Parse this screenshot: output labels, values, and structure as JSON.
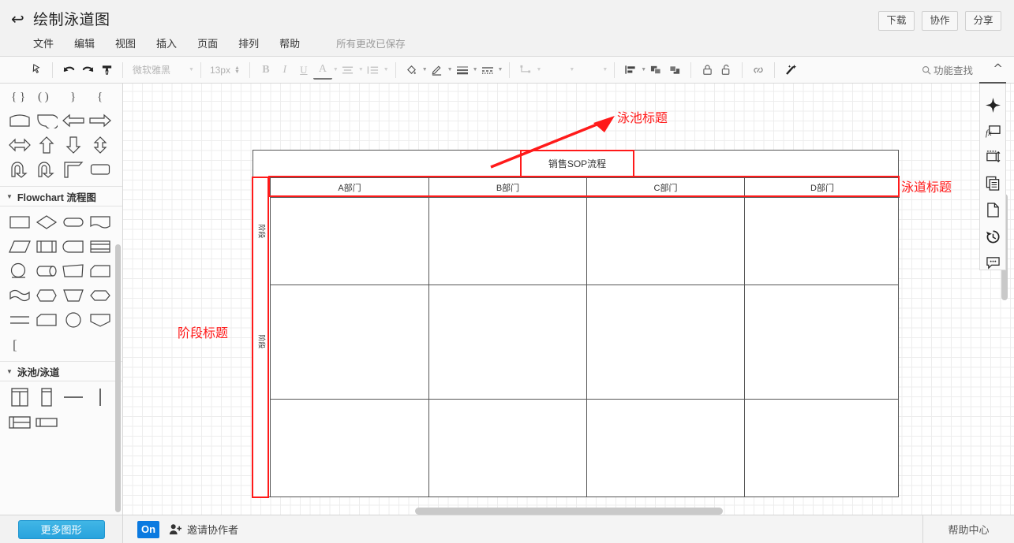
{
  "header": {
    "back_icon": "back-arrow-icon",
    "title": "绘制泳道图",
    "menus": [
      "文件",
      "编辑",
      "视图",
      "插入",
      "页面",
      "排列",
      "帮助"
    ],
    "save_status": "所有更改已保存",
    "buttons": [
      "下载",
      "协作",
      "分享"
    ]
  },
  "toolbar": {
    "pointer_icon": "cursor-select-icon",
    "undo_icon": "undo-icon",
    "redo_icon": "redo-icon",
    "format_painter_icon": "format-painter-icon",
    "font_family": "微软雅黑",
    "font_size": "13px",
    "bold": "B",
    "italic": "I",
    "underline": "U",
    "font_color": "A",
    "align_icon": "text-align-icon",
    "line_spacing_icon": "line-spacing-icon",
    "fill_icon": "fill-bucket-icon",
    "line_color_icon": "pen-icon",
    "line_weight_icon": "line-weight-icon",
    "line_style_icon": "line-dash-icon",
    "connector_icon": "connector-elbow-icon",
    "arrow_start_icon": "arrow-start-icon",
    "arrow_end_icon": "arrow-end-icon",
    "distribute_icon": "align-objects-icon",
    "bring_front_icon": "bring-to-front-icon",
    "send_back_icon": "send-to-back-icon",
    "lock_icon": "lock-icon",
    "unlock_icon": "unlock-icon",
    "link_icon": "link-icon",
    "magic_icon": "magic-wand-icon",
    "search_label": "功能查找",
    "search_icon": "search-icon",
    "collapse_icon": "chevron-up-icon"
  },
  "left_panel": {
    "top_shapes": [
      "brace-left-right",
      "paren-left-right",
      "brace-right",
      "brace-single",
      "flag-banner",
      "pie-quarter",
      "arrow-left",
      "arrow-right",
      "arrow-left-right",
      "arrow-up",
      "arrow-down",
      "arrow-up-down",
      "u-turn-arrow",
      "curved-arrow",
      "corner-bracket",
      "rounded-rect"
    ],
    "sections": [
      {
        "title": "Flowchart 流程图",
        "expand_icon": "triangle-down-icon",
        "shapes": [
          "process-rect",
          "decision-diamond",
          "terminator-rounded",
          "document",
          "data-parallelogram",
          "predefined-process",
          "internal-storage",
          "multi-document",
          "connector-circle",
          "direct-access-storage",
          "manual-operation",
          "card",
          "wave-document",
          "preparation-hexagon",
          "manual-input",
          "hexagon",
          "lines-pair",
          "display-shape",
          "circle",
          "pentagon-down",
          "left-bracket"
        ]
      },
      {
        "title": "泳池/泳道",
        "expand_icon": "triangle-down-icon",
        "shapes": [
          "pool-vertical-2lane",
          "pool-vertical-1lane",
          "lane-divider-horizontal",
          "lane-divider-vertical",
          "pool-horizontal-2lane",
          "pool-horizontal-1lane"
        ]
      }
    ],
    "more_shapes_button": "更多图形"
  },
  "canvas": {
    "diagram": {
      "pool_title": "销售SOP流程",
      "lanes": [
        "A部门",
        "B部门",
        "C部门",
        "D部门"
      ],
      "stages": [
        "阶段",
        "阶段"
      ]
    },
    "annotations": [
      {
        "label": "泳池标题",
        "target": "pool-title-box"
      },
      {
        "label": "泳道标题",
        "target": "lane-header-row"
      },
      {
        "label": "阶段标题",
        "target": "stage-column"
      }
    ],
    "annotation_color": "#ff1a1a"
  },
  "right_rail": {
    "items": [
      "navigator-compass-icon",
      "formula-fx-icon",
      "resize-canvas-icon",
      "pages-copy-icon",
      "new-page-icon",
      "history-clock-icon",
      "comment-bubble-icon"
    ]
  },
  "bottom_bar": {
    "on_badge": "On",
    "invite_icon": "add-person-icon",
    "invite_label": "邀请协作者",
    "help_center": "帮助中心"
  }
}
